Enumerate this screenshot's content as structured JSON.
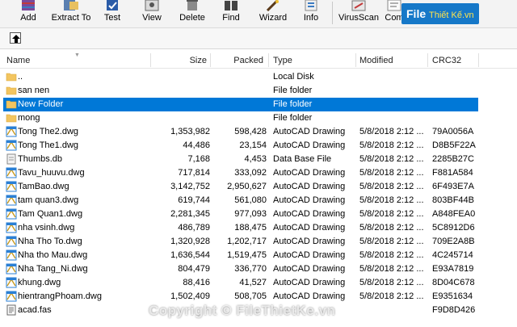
{
  "toolbar": {
    "buttons": [
      {
        "label": "Add",
        "icon": "add-archive-icon"
      },
      {
        "label": "Extract To",
        "icon": "extract-icon"
      },
      {
        "label": "Test",
        "icon": "test-icon"
      },
      {
        "label": "View",
        "icon": "view-icon"
      },
      {
        "label": "Delete",
        "icon": "delete-icon"
      },
      {
        "label": "Find",
        "icon": "find-icon"
      },
      {
        "label": "Wizard",
        "icon": "wizard-icon"
      },
      {
        "label": "Info",
        "icon": "info-icon"
      },
      {
        "label": "VirusScan",
        "icon": "virusscan-icon"
      },
      {
        "label": "Com",
        "icon": "comment-icon"
      }
    ],
    "brand_main": "File",
    "brand_sub": "Thiết Kế.vn"
  },
  "columns": {
    "name": "Name",
    "size": "Size",
    "packed": "Packed",
    "type": "Type",
    "modified": "Modified",
    "crc": "CRC32"
  },
  "rows": [
    {
      "name": "..",
      "size": "",
      "packed": "",
      "type": "Local Disk",
      "modified": "",
      "crc": "",
      "icon": "folder"
    },
    {
      "name": "san nen",
      "size": "",
      "packed": "",
      "type": "File folder",
      "modified": "",
      "crc": "",
      "icon": "folder"
    },
    {
      "name": "New Folder",
      "size": "",
      "packed": "",
      "type": "File folder",
      "modified": "",
      "crc": "",
      "icon": "folder",
      "selected": true
    },
    {
      "name": "mong",
      "size": "",
      "packed": "",
      "type": "File folder",
      "modified": "",
      "crc": "",
      "icon": "folder"
    },
    {
      "name": "Tong The2.dwg",
      "size": "1,353,982",
      "packed": "598,428",
      "type": "AutoCAD Drawing",
      "modified": "5/8/2018 2:12 ...",
      "crc": "79A0056A",
      "icon": "dwg"
    },
    {
      "name": "Tong The1.dwg",
      "size": "44,486",
      "packed": "23,154",
      "type": "AutoCAD Drawing",
      "modified": "5/8/2018 2:12 ...",
      "crc": "D8B5F22A",
      "icon": "dwg"
    },
    {
      "name": "Thumbs.db",
      "size": "7,168",
      "packed": "4,453",
      "type": "Data Base File",
      "modified": "5/8/2018 2:12 ...",
      "crc": "2285B27C",
      "icon": "db"
    },
    {
      "name": "Tavu_huuvu.dwg",
      "size": "717,814",
      "packed": "333,092",
      "type": "AutoCAD Drawing",
      "modified": "5/8/2018 2:12 ...",
      "crc": "F881A584",
      "icon": "dwg"
    },
    {
      "name": "TamBao.dwg",
      "size": "3,142,752",
      "packed": "2,950,627",
      "type": "AutoCAD Drawing",
      "modified": "5/8/2018 2:12 ...",
      "crc": "6F493E7A",
      "icon": "dwg"
    },
    {
      "name": "tam quan3.dwg",
      "size": "619,744",
      "packed": "561,080",
      "type": "AutoCAD Drawing",
      "modified": "5/8/2018 2:12 ...",
      "crc": "803BF44B",
      "icon": "dwg"
    },
    {
      "name": "Tam Quan1.dwg",
      "size": "2,281,345",
      "packed": "977,093",
      "type": "AutoCAD Drawing",
      "modified": "5/8/2018 2:12 ...",
      "crc": "A848FEA0",
      "icon": "dwg"
    },
    {
      "name": "nha vsinh.dwg",
      "size": "486,789",
      "packed": "188,475",
      "type": "AutoCAD Drawing",
      "modified": "5/8/2018 2:12 ...",
      "crc": "5C8912D6",
      "icon": "dwg"
    },
    {
      "name": "Nha Tho To.dwg",
      "size": "1,320,928",
      "packed": "1,202,717",
      "type": "AutoCAD Drawing",
      "modified": "5/8/2018 2:12 ...",
      "crc": "709E2A8B",
      "icon": "dwg"
    },
    {
      "name": "Nha tho Mau.dwg",
      "size": "1,636,544",
      "packed": "1,519,475",
      "type": "AutoCAD Drawing",
      "modified": "5/8/2018 2:12 ...",
      "crc": "4C245714",
      "icon": "dwg"
    },
    {
      "name": "Nha Tang_Ni.dwg",
      "size": "804,479",
      "packed": "336,770",
      "type": "AutoCAD Drawing",
      "modified": "5/8/2018 2:12 ...",
      "crc": "E93A7819",
      "icon": "dwg"
    },
    {
      "name": "khung.dwg",
      "size": "88,416",
      "packed": "41,527",
      "type": "AutoCAD Drawing",
      "modified": "5/8/2018 2:12 ...",
      "crc": "8D04C678",
      "icon": "dwg"
    },
    {
      "name": "hientrangPhoam.dwg",
      "size": "1,502,409",
      "packed": "508,705",
      "type": "AutoCAD Drawing",
      "modified": "5/8/2018 2:12 ...",
      "crc": "E9351634",
      "icon": "dwg"
    },
    {
      "name": "acad.fas",
      "size": "",
      "packed": "",
      "type": "",
      "modified": "",
      "crc": "F9D8D426",
      "icon": "fas"
    }
  ],
  "watermark": "Copyright © FileThietKe.vn",
  "colors": {
    "selection": "#0078d7",
    "folder": "#f3c560",
    "dwg": "#2a7fd4"
  }
}
